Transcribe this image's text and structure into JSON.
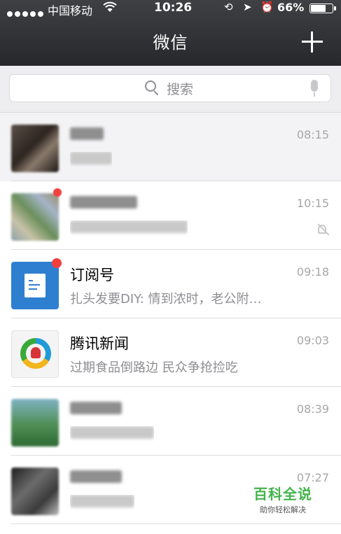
{
  "status_bar": {
    "carrier": "中国移动",
    "time": "10:26",
    "battery_percent": "66%",
    "battery_level": 0.66
  },
  "header": {
    "title": "微信"
  },
  "search": {
    "placeholder": "搜索"
  },
  "chats": [
    {
      "name": "",
      "preview": "",
      "time": "08:15",
      "pinned": true,
      "avatar_icon": "blurred-photo"
    },
    {
      "name": "",
      "preview": "",
      "time": "10:15",
      "muted": true,
      "unread": true,
      "avatar_icon": "blurred-group-photo"
    },
    {
      "name": "订阅号",
      "preview": "扎头发要DIY: 情到浓时，老公附…",
      "time": "09:18",
      "unread": true,
      "avatar_icon": "document-icon"
    },
    {
      "name": "腾讯新闻",
      "preview": "过期食品倒路边 民众争抢捡吃",
      "time": "09:03",
      "avatar_icon": "tencent-news-icon"
    },
    {
      "name": "",
      "preview": "",
      "time": "08:39",
      "avatar_icon": "blurred-landscape-photo"
    },
    {
      "name": "",
      "preview": "",
      "time": "07:27",
      "avatar_icon": "blurred-photo"
    }
  ],
  "watermark": {
    "title": "百科全说",
    "subtitle": "助你轻松解决"
  },
  "colors": {
    "navbar": "#2e2f32",
    "subscription_blue": "#2f7fd1",
    "badge_red": "#f33f3f",
    "watermark_green": "#43b34a"
  }
}
